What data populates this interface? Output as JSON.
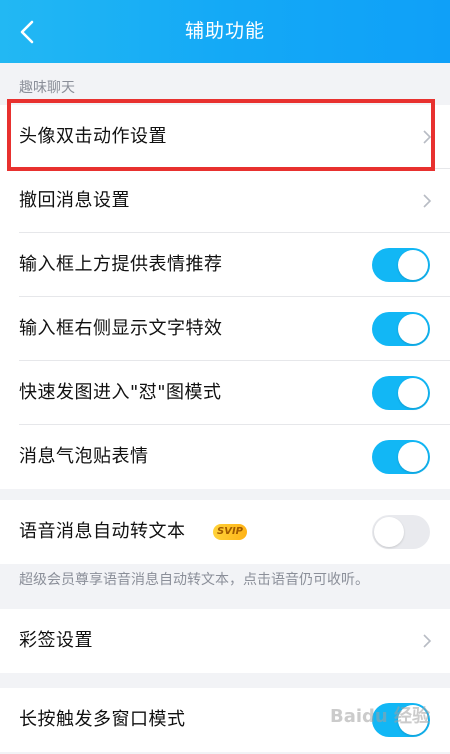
{
  "header": {
    "title": "辅助功能",
    "back_icon": "chevron-left-icon"
  },
  "section": {
    "label": "趣味聊天"
  },
  "rows": [
    {
      "label": "头像双击动作设置",
      "control": "chevron"
    },
    {
      "label": "撤回消息设置",
      "control": "chevron"
    },
    {
      "label": "输入框上方提供表情推荐",
      "control": "toggle",
      "on": true
    },
    {
      "label": "输入框右侧显示文字特效",
      "control": "toggle",
      "on": true
    },
    {
      "label": "快速发图进入\"怼\"图模式",
      "control": "toggle",
      "on": true
    },
    {
      "label": "消息气泡贴表情",
      "control": "toggle",
      "on": true
    },
    {
      "label": "语音消息自动转文本",
      "control": "toggle",
      "on": false,
      "badge": "SVIP"
    },
    {
      "label": "彩签设置",
      "control": "chevron"
    },
    {
      "label": "长按触发多窗口模式",
      "control": "toggle",
      "on": true
    }
  ],
  "note": "超级会员尊享语音消息自动转文本，点击语音仍可收听。",
  "watermark": "Baidu 经验",
  "colors": {
    "accent": "#12b7f5",
    "highlight": "#e8312f"
  }
}
